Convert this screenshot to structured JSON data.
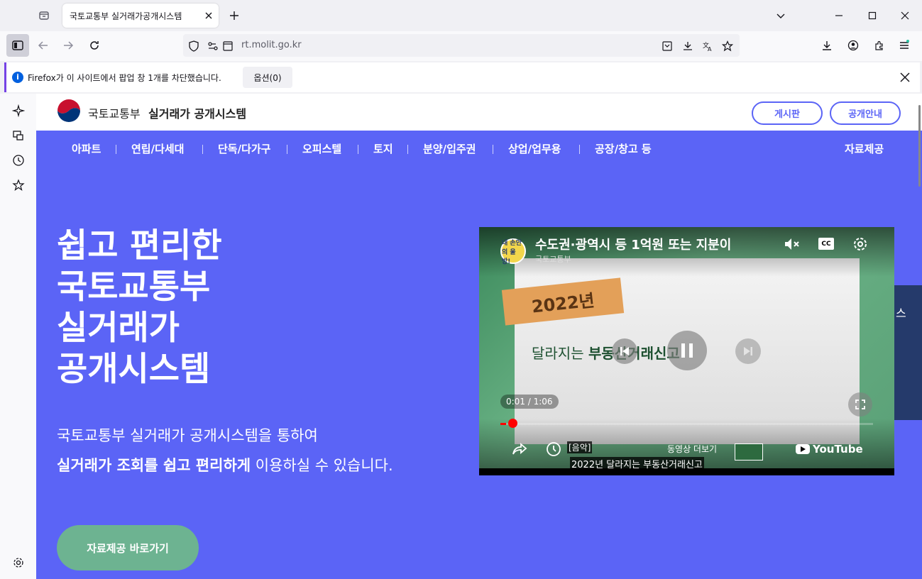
{
  "browser": {
    "tab_title": "국토교통부 실거래가공개시스템",
    "url": "rt.molit.go.kr"
  },
  "notification": {
    "text": "Firefox가 이 사이트에서 팝업 창 1개를 차단했습니다.",
    "options_label": "옵션(0)"
  },
  "site": {
    "org_name": "국토교통부",
    "system_name": "실거래가 공개시스템",
    "header_buttons": [
      "게시판",
      "공개안내"
    ],
    "nav": [
      "아파트",
      "연립/다세대",
      "단독/다가구",
      "오피스텔",
      "토지",
      "분양/입주권",
      "상업/업무용",
      "공장/창고 등"
    ],
    "nav_right": "자료제공",
    "hero_title": [
      "쉽고 편리한",
      "국토교통부",
      "실거래가",
      "공개시스템"
    ],
    "hero_desc1": "국토교통부 실거래가 공개시스템을 통하여",
    "hero_desc2_bold": "실거래가 조회를 쉽고 편리하게",
    "hero_desc2_rest": " 이용하실 수 있습니다.",
    "cta_label": "자료제공 바로가기",
    "side_tab_text": "스"
  },
  "video": {
    "title": "수도권·광역시 등 1억원 또는 지분이",
    "channel": "국토교통부",
    "avatar_text": "내 손안의 울방!",
    "tag_text": "2022년",
    "subtitle_prefix": "달라지는 ",
    "subtitle_bold": "부동산거래신고",
    "time": "0:01 / 1:06",
    "progress": 0.015,
    "caption1": "[음악]",
    "caption2": "2022년 달라지는 부동산거래신고",
    "more_videos": "동영상 더보기",
    "brand": "YouTube",
    "cc_label": "CC"
  },
  "colors": {
    "page_bg": "#5b64f6",
    "cta": "#6db391",
    "side_tab": "#253a6b"
  }
}
